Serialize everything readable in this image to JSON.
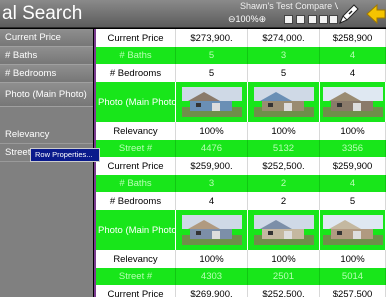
{
  "header": {
    "title": "al Search",
    "subtitle": "Shawn's Test Compare Vie",
    "zoom": "100%",
    "icons": [
      "zoom-out-icon",
      "zoom-in-icon",
      "save-icon",
      "print-icon",
      "email-icon",
      "trash-icon",
      "edit-icon",
      "pen-icon",
      "back-arrow-icon"
    ]
  },
  "sidebar": {
    "items": [
      {
        "label": "Current Price"
      },
      {
        "label": "# Baths"
      },
      {
        "label": "# Bedrooms"
      },
      {
        "label": "Photo (Main Photo)"
      },
      {
        "label": "Relevancy"
      },
      {
        "label": "Street #"
      }
    ]
  },
  "context_menu": {
    "label": "Row Properties..."
  },
  "grid": {
    "rows": [
      {
        "kind": "white",
        "label": "Current Price",
        "values": [
          "$273,900.",
          "$274,000.",
          "$258,900"
        ]
      },
      {
        "kind": "green",
        "label": "# Baths",
        "values": [
          "5",
          "3",
          "4"
        ]
      },
      {
        "kind": "white",
        "label": "# Bedrooms",
        "values": [
          "5",
          "5",
          "4"
        ]
      },
      {
        "kind": "photo",
        "label": "Photo (Main Photo)"
      },
      {
        "kind": "white",
        "label": "Relevancy",
        "values": [
          "100%",
          "100%",
          "100%"
        ]
      },
      {
        "kind": "green",
        "label": "Street #",
        "values": [
          "4476",
          "5132",
          "3356"
        ]
      },
      {
        "kind": "white",
        "label": "Current Price",
        "values": [
          "$259,900.",
          "$252,500.",
          "$259,900"
        ]
      },
      {
        "kind": "green",
        "label": "# Baths",
        "values": [
          "3",
          "2",
          "4"
        ]
      },
      {
        "kind": "white",
        "label": "# Bedrooms",
        "values": [
          "4",
          "2",
          "5"
        ]
      },
      {
        "kind": "photo",
        "label": "Photo (Main Photo)"
      },
      {
        "kind": "white",
        "label": "Relevancy",
        "values": [
          "100%",
          "100%",
          "100%"
        ]
      },
      {
        "kind": "green",
        "label": "Street #",
        "values": [
          "4303",
          "2501",
          "5014"
        ]
      },
      {
        "kind": "white",
        "label": "Current Price",
        "values": [
          "$269,900.",
          "$252,500.",
          "$257,500"
        ]
      }
    ]
  },
  "colors": {
    "green_row": "#18e61a",
    "header": "#6e6e6e",
    "sidebar": "#808080",
    "menu_highlight": "#0a1a8c"
  }
}
